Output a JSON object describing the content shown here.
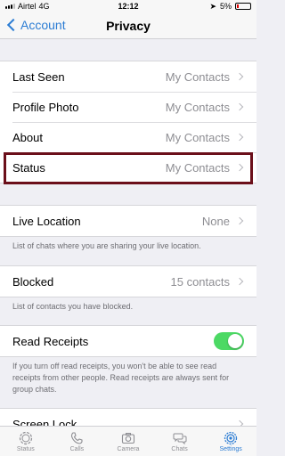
{
  "status_bar": {
    "carrier": "Airtel",
    "network": "4G",
    "time": "12:12",
    "battery": "5%"
  },
  "nav": {
    "back_label": "Account",
    "title": "Privacy"
  },
  "group1": [
    {
      "label": "Last Seen",
      "value": "My Contacts"
    },
    {
      "label": "Profile Photo",
      "value": "My Contacts"
    },
    {
      "label": "About",
      "value": "My Contacts"
    },
    {
      "label": "Status",
      "value": "My Contacts"
    }
  ],
  "live_location": {
    "label": "Live Location",
    "value": "None",
    "note": "List of chats where you are sharing your live location."
  },
  "blocked": {
    "label": "Blocked",
    "value": "15 contacts",
    "note": "List of contacts you have blocked."
  },
  "read_receipts": {
    "label": "Read Receipts",
    "enabled": true,
    "note": "If you turn off read receipts, you won't be able to see read receipts from other people. Read receipts are always sent for group chats."
  },
  "screen_lock": {
    "label": "Screen Lock"
  },
  "tabs": [
    {
      "label": "Status",
      "icon": "status-icon",
      "active": false
    },
    {
      "label": "Calls",
      "icon": "phone-icon",
      "active": false
    },
    {
      "label": "Camera",
      "icon": "camera-icon",
      "active": false
    },
    {
      "label": "Chats",
      "icon": "chats-icon",
      "active": false
    },
    {
      "label": "Settings",
      "icon": "gear-icon",
      "active": true
    }
  ],
  "colors": {
    "accent": "#2b7cd3",
    "toggle_on": "#4cd964",
    "highlight_border": "#6b0f1a"
  }
}
